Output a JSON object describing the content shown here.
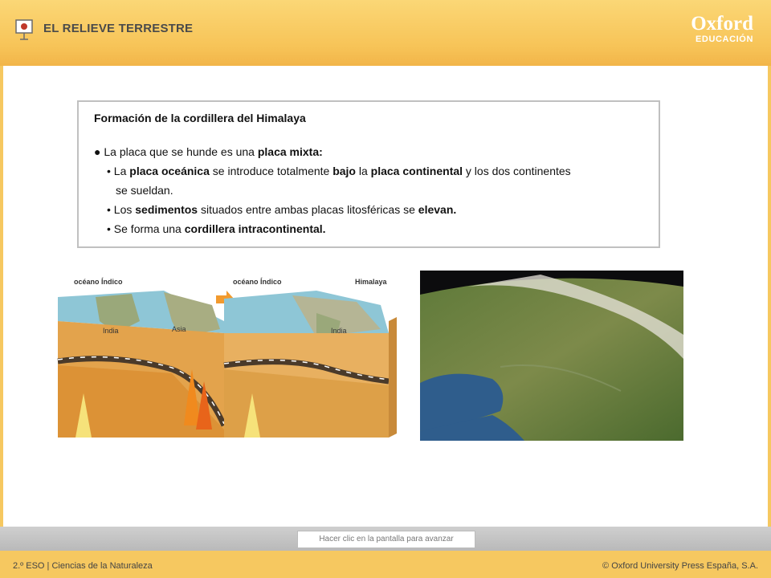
{
  "header": {
    "title": "EL RELIEVE TERRESTRE",
    "logo_top": "Oxford",
    "logo_bottom": "EDUCACIÓN"
  },
  "textbox": {
    "title": "Formación de la cordillera del Himalaya",
    "main_bullet": [
      "La placa que se hunde es una ",
      "placa mixta:"
    ],
    "sub_bullet_1": [
      "La ",
      "placa oceánica",
      " se introduce totalmente ",
      "bajo",
      " la ",
      "placa continental",
      " y los dos continentes"
    ],
    "sub_bullet_1_cont": "se sueldan.",
    "sub_bullet_2": [
      "Los ",
      "sedimentos",
      " situados entre ambas placas litosféricas se ",
      "elevan."
    ],
    "sub_bullet_3": [
      "Se forma una ",
      "cordillera intracontinental."
    ]
  },
  "diagram": {
    "left_label_ocean": "océano Índico",
    "left_label_india": "India",
    "left_label_asia": "Asia",
    "right_label_ocean": "océano Índico",
    "right_label_himalaya": "Himalaya",
    "right_label_india": "India"
  },
  "advance_prompt": "Hacer clic en la pantalla para avanzar",
  "footer": {
    "left": "2.º ESO | Ciencias de la Naturaleza",
    "right": "© Oxford University Press España, S.A."
  }
}
